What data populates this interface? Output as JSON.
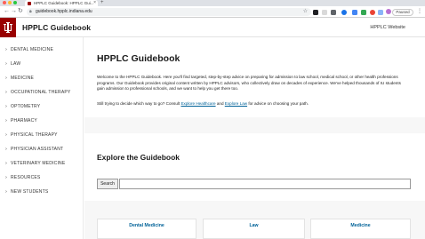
{
  "browser": {
    "tab_title": "HPPLC Guidebook: HPPLC Gui...",
    "url": "guidebook.hpplc.indiana.edu",
    "profile_status": "Paused",
    "colors": {
      "close": "#ff5f57",
      "minimize": "#febc2e",
      "maximize": "#28c840"
    },
    "icons": [
      "back-arrow-icon",
      "forward-arrow-icon",
      "reload-icon",
      "lock-icon",
      "star-icon",
      "kebab-menu-icon"
    ]
  },
  "header": {
    "site_title": "HPPLC Guidebook",
    "site_link": "HPPLC Website",
    "brand_color": "#990000"
  },
  "sidebar": {
    "items": [
      {
        "label": "DENTAL MEDICINE"
      },
      {
        "label": "LAW"
      },
      {
        "label": "MEDICINE"
      },
      {
        "label": "OCCUPATIONAL THERAPY"
      },
      {
        "label": "OPTOMETRY"
      },
      {
        "label": "PHARMACY"
      },
      {
        "label": "PHYSICAL THERAPY"
      },
      {
        "label": "PHYSICIAN ASSISTANT"
      },
      {
        "label": "VETERINARY MEDICINE"
      },
      {
        "label": "RESOURCES"
      },
      {
        "label": "NEW STUDENTS"
      }
    ]
  },
  "main": {
    "title": "HPPLC Guidebook",
    "intro": "Welcome to the HPPLC Guidebook. Here you'll find targeted, step-by-step advice on preparing for admission to law school, medical school, or other health professions programs. Our Guidebook provides original content written by HPPLC advisors, who collectively draw on decades of experience. We've helped thousands of IU students gain admission to professional schools, and we want to help you get there too.",
    "cta": {
      "before": "Still trying to decide which way to go? Consult ",
      "link1": "Explore Healthcare",
      "middle": " and ",
      "link2": "Explore Law",
      "after": " for advice on choosing your path."
    },
    "explore_title": "Explore the Guidebook",
    "search_label": "Search",
    "cards": [
      {
        "label": "Dental Medicine"
      },
      {
        "label": "Law"
      },
      {
        "label": "Medicine"
      }
    ],
    "link_color": "#006298"
  }
}
